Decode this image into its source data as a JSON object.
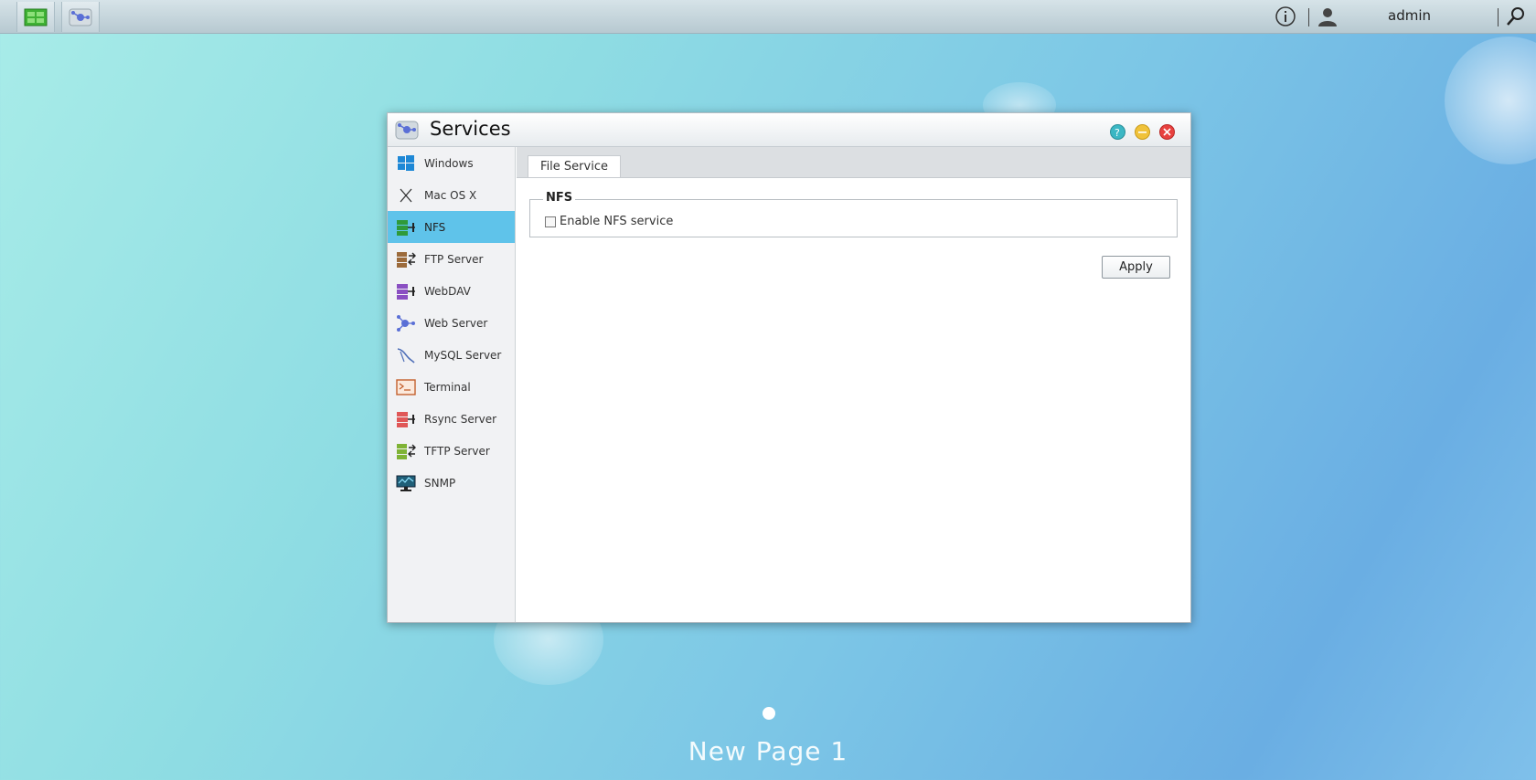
{
  "topbar": {
    "username": "admin",
    "apps": [
      "app-manager-icon",
      "services-app-icon"
    ],
    "icons": [
      "info-icon",
      "user-icon",
      "search-icon"
    ]
  },
  "window": {
    "title": "Services",
    "controls": [
      "help-icon",
      "minimize-icon",
      "close-icon"
    ],
    "sidebar": [
      {
        "label": "Windows",
        "icon": "windows-icon"
      },
      {
        "label": "Mac OS X",
        "icon": "macos-icon"
      },
      {
        "label": "NFS",
        "icon": "nfs-icon",
        "active": true
      },
      {
        "label": "FTP Server",
        "icon": "ftp-icon"
      },
      {
        "label": "WebDAV",
        "icon": "webdav-icon"
      },
      {
        "label": "Web Server",
        "icon": "web-server-icon"
      },
      {
        "label": "MySQL Server",
        "icon": "mysql-icon"
      },
      {
        "label": "Terminal",
        "icon": "terminal-icon"
      },
      {
        "label": "Rsync Server",
        "icon": "rsync-icon"
      },
      {
        "label": "TFTP Server",
        "icon": "tftp-icon"
      },
      {
        "label": "SNMP",
        "icon": "snmp-icon"
      }
    ],
    "tab": "File Service",
    "group_title": "NFS",
    "checkbox_label": "Enable NFS service",
    "checkbox_checked": false,
    "apply_label": "Apply"
  },
  "desktop": {
    "page_label": "New Page 1"
  }
}
